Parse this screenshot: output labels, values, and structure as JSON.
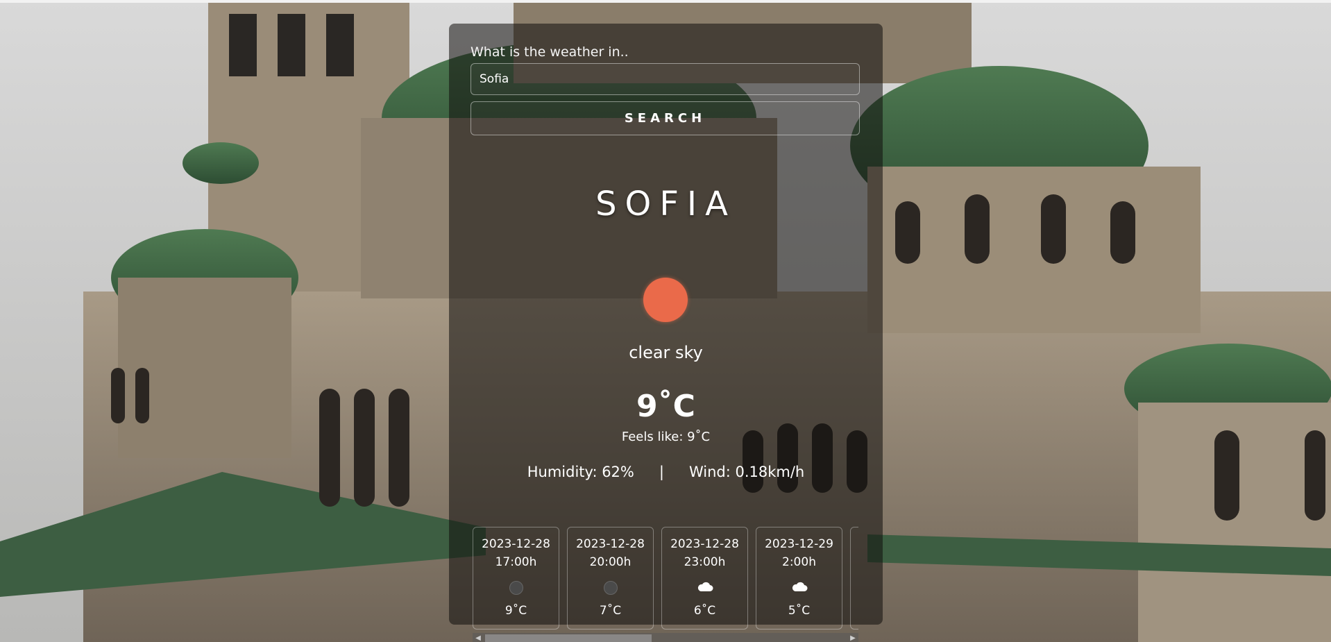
{
  "search": {
    "prompt": "What is the weather in..",
    "value": "Sofia",
    "button_label": "SEARCH"
  },
  "current": {
    "city": "SOFIA",
    "icon": "sun-icon",
    "description": "clear sky",
    "temperature": "9˚C",
    "feels_like": "Feels like: 9˚C",
    "humidity": "Humidity: 62%",
    "separator": "|",
    "wind": "Wind: 0.18km/h"
  },
  "forecast": [
    {
      "date": "2023-12-28",
      "time": "17:00h",
      "icon": "clear-night-icon",
      "temp": "9˚C"
    },
    {
      "date": "2023-12-28",
      "time": "20:00h",
      "icon": "clear-night-icon",
      "temp": "7˚C"
    },
    {
      "date": "2023-12-28",
      "time": "23:00h",
      "icon": "cloud-icon",
      "temp": "6˚C"
    },
    {
      "date": "2023-12-29",
      "time": "2:00h",
      "icon": "cloud-icon",
      "temp": "5˚C"
    }
  ],
  "scrollbar": {
    "left_arrow": "◀",
    "right_arrow": "▶"
  },
  "colors": {
    "sun": "#ea6a4a",
    "card_overlay": "rgba(16,14,13,0.55)"
  }
}
